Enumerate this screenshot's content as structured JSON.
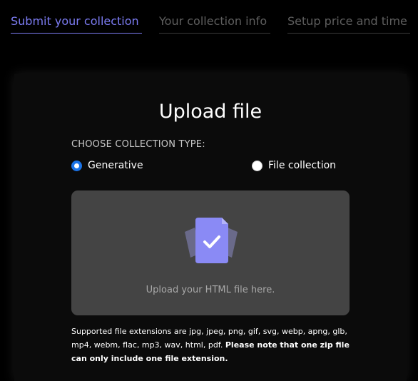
{
  "tabs": [
    {
      "label": "Submit your collection",
      "active": true
    },
    {
      "label": "Your collection info",
      "active": false
    },
    {
      "label": "Setup price and time",
      "active": false
    }
  ],
  "upload": {
    "title": "Upload file",
    "type_label": "CHOOSE COLLECTION TYPE:",
    "options": [
      {
        "label": "Generative",
        "selected": true
      },
      {
        "label": "File collection",
        "selected": false
      }
    ],
    "dropzone_text": "Upload your HTML file here.",
    "note_text": "Supported file extensions are jpg, jpeg, png, gif, svg, webp, apng, glb, mp4, webm, flac, mp3, wav, html, pdf.",
    "note_bold": "Please note that one zip file can only include one file extension."
  },
  "colors": {
    "accent": "#7c7cf3",
    "radio_selected": "#1a73e8",
    "dropzone_bg": "#444444"
  },
  "icons": [
    "file-check-icon"
  ]
}
